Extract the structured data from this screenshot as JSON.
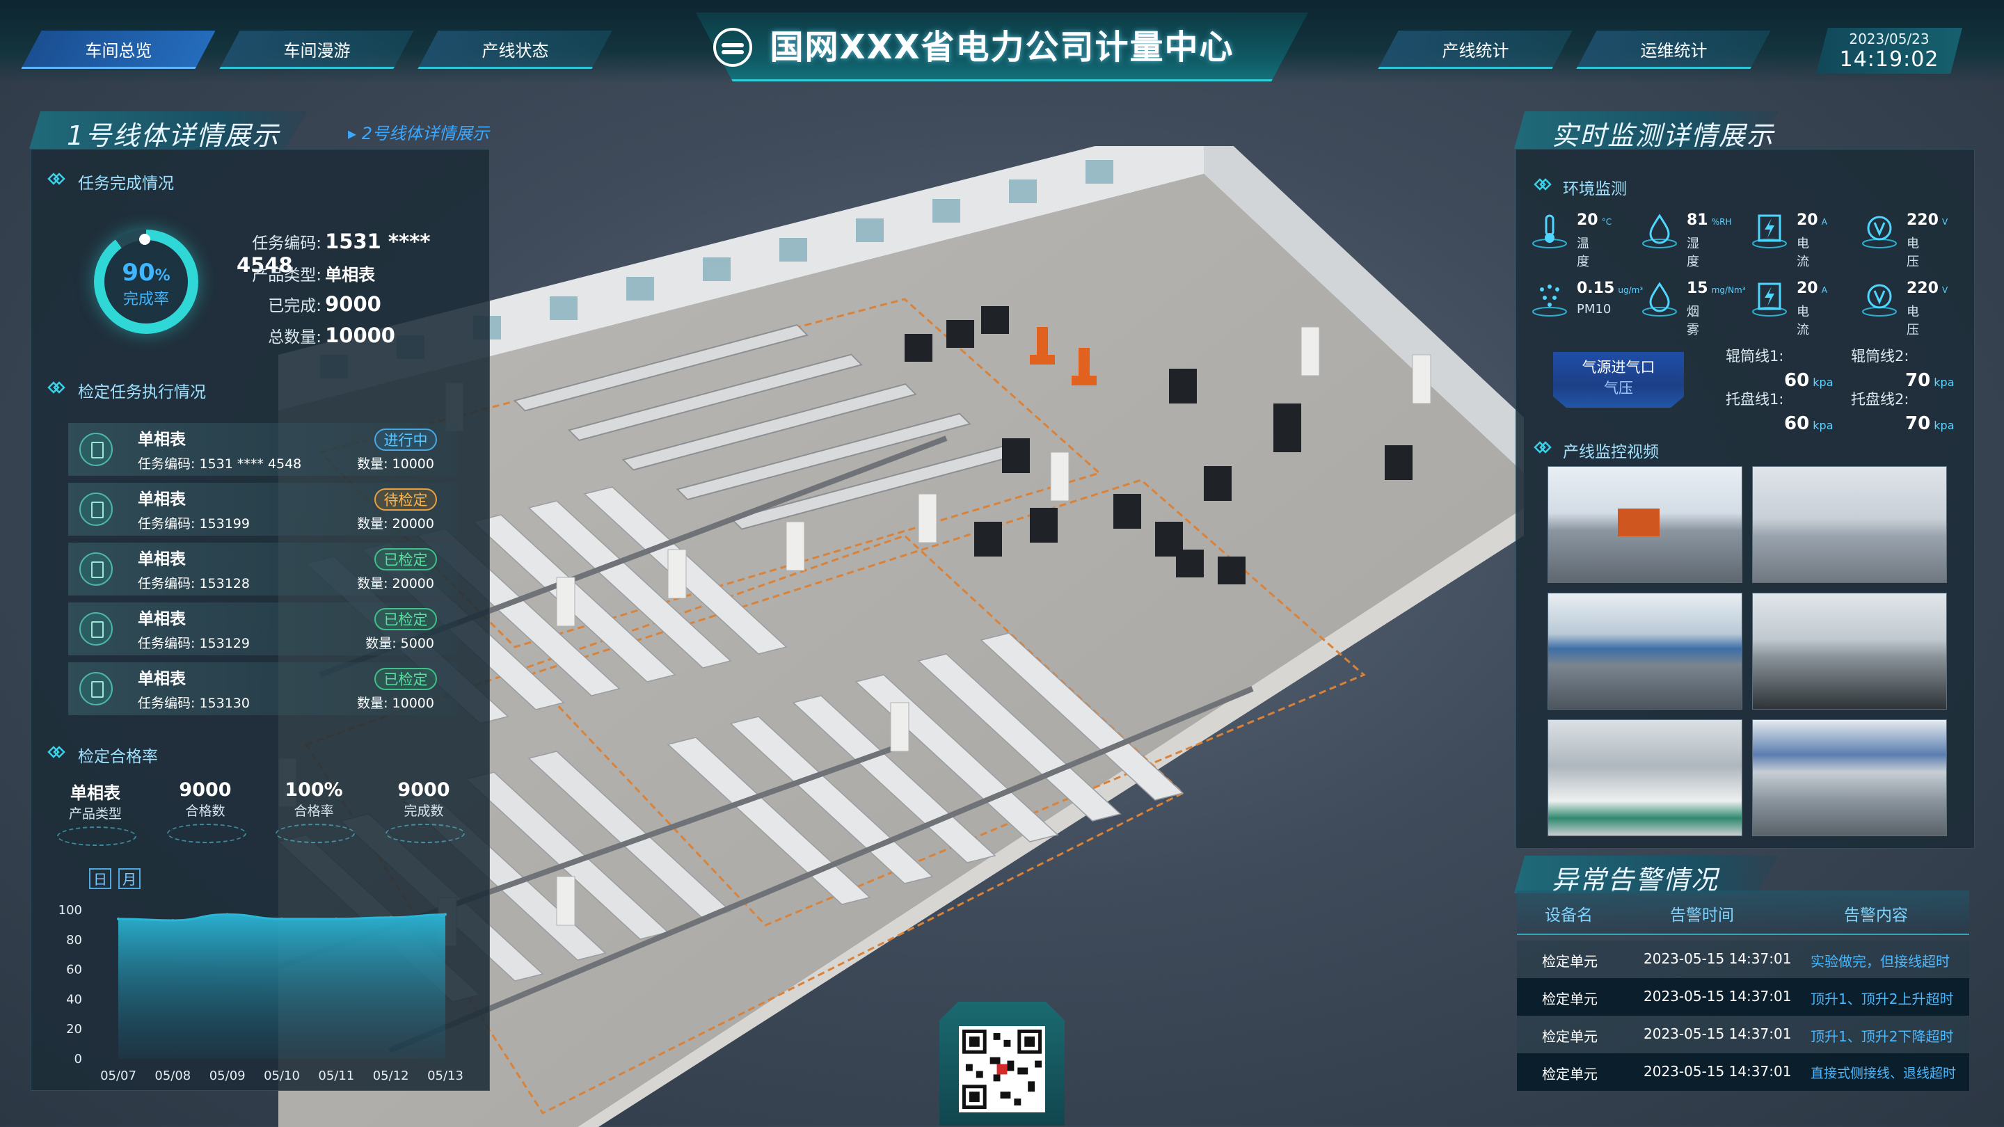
{
  "header": {
    "title": "国网XXX省电力公司计量中心",
    "nav_left": [
      "车间总览",
      "车间漫游",
      "产线状态"
    ],
    "nav_right": [
      "产线统计",
      "运维统计"
    ],
    "date": "2023/05/23",
    "time": "14:19:02"
  },
  "left": {
    "section_title": "1号线体详情展示",
    "section_link": "2号线体详情展示",
    "task_title": "任务完成情况",
    "progress": {
      "value": "90",
      "unit": "%",
      "label": "完成率",
      "fraction": 0.9
    },
    "task_info": [
      {
        "label": "任务编码:",
        "value": "1531 **** 4548"
      },
      {
        "label": "产品类型:",
        "value": "单相表"
      },
      {
        "label": "已完成:",
        "value": "9000"
      },
      {
        "label": "总数量:",
        "value": "10000"
      }
    ],
    "exec_title": "检定任务执行情况",
    "tasks": [
      {
        "name": "单相表",
        "code_label": "任务编码:",
        "code": "1531 **** 4548",
        "qty_label": "数量:",
        "qty": "10000",
        "status": "进行中",
        "status_color": "blue"
      },
      {
        "name": "单相表",
        "code_label": "任务编码:",
        "code": "153199",
        "qty_label": "数量:",
        "qty": "20000",
        "status": "待检定",
        "status_color": "orange"
      },
      {
        "name": "单相表",
        "code_label": "任务编码:",
        "code": "153128",
        "qty_label": "数量:",
        "qty": "20000",
        "status": "已检定",
        "status_color": "green"
      },
      {
        "name": "单相表",
        "code_label": "任务编码:",
        "code": "153129",
        "qty_label": "数量:",
        "qty": "5000",
        "status": "已检定",
        "status_color": "green"
      },
      {
        "name": "单相表",
        "code_label": "任务编码:",
        "code": "153130",
        "qty_label": "数量:",
        "qty": "10000",
        "status": "已检定",
        "status_color": "green"
      }
    ],
    "pass_title": "检定合格率",
    "pass_stats": [
      {
        "value": "单相表",
        "label": "产品类型"
      },
      {
        "value": "9000",
        "label": "合格数"
      },
      {
        "value": "100%",
        "label": "合格率"
      },
      {
        "value": "9000",
        "label": "完成数"
      }
    ],
    "toggle": [
      "日",
      "月"
    ]
  },
  "chart_data": {
    "type": "area",
    "x": [
      "05/07",
      "05/08",
      "05/09",
      "05/10",
      "05/11",
      "05/12",
      "05/13"
    ],
    "values": [
      94,
      93,
      97,
      94,
      94,
      95,
      97
    ],
    "ylim": [
      0,
      100
    ],
    "yticks": [
      0,
      20,
      40,
      60,
      80,
      100
    ],
    "color": "#2ab6d6"
  },
  "right": {
    "section_title": "实时监测详情展示",
    "env_title": "环境监测",
    "env": [
      {
        "value": "20",
        "unit": "°C",
        "label": "温度",
        "icon": "thermometer-icon"
      },
      {
        "value": "81",
        "unit": "%RH",
        "label": "湿度",
        "icon": "droplet-icon"
      },
      {
        "value": "20",
        "unit": "A",
        "label": "电流",
        "icon": "lightning-icon"
      },
      {
        "value": "220",
        "unit": "V",
        "label": "电压",
        "icon": "voltage-icon"
      },
      {
        "value": "0.15",
        "unit": "ug/m³",
        "label": "PM10",
        "icon": "dust-icon"
      },
      {
        "value": "15",
        "unit": "mg/Nm³",
        "label": "烟雾",
        "icon": "droplet-icon"
      },
      {
        "value": "20",
        "unit": "A",
        "label": "电流",
        "icon": "lightning-icon"
      },
      {
        "value": "220",
        "unit": "V",
        "label": "电压",
        "icon": "voltage-icon"
      }
    ],
    "pressure_box": {
      "line1": "气源进气口",
      "line2": "气压"
    },
    "pressures": [
      {
        "label": "辊筒线1:",
        "value": "60",
        "unit": "kpa"
      },
      {
        "label": "辊筒线2:",
        "value": "70",
        "unit": "kpa"
      },
      {
        "label": "托盘线1:",
        "value": "60",
        "unit": "kpa"
      },
      {
        "label": "托盘线2:",
        "value": "70",
        "unit": "kpa"
      }
    ],
    "video_title": "产线监控视频",
    "alarm_title": "异常告警情况",
    "alarm_headers": [
      "设备名",
      "告警时间",
      "告警内容"
    ],
    "alarms": [
      {
        "device": "检定单元",
        "time": "2023-05-15 14:37:01",
        "content": "实验做完，但接线超时"
      },
      {
        "device": "检定单元",
        "time": "2023-05-15 14:37:01",
        "content": "顶升1、顶升2上升超时"
      },
      {
        "device": "检定单元",
        "time": "2023-05-15 14:37:01",
        "content": "顶升1、顶升2下降超时"
      },
      {
        "device": "检定单元",
        "time": "2023-05-15 14:37:01",
        "content": "直接式侧接线、退线超时"
      }
    ]
  },
  "colors": {
    "accent": "#2fd0d8",
    "blue": "#48b8ff",
    "orange": "#ffb54a",
    "green": "#58e0a0"
  }
}
